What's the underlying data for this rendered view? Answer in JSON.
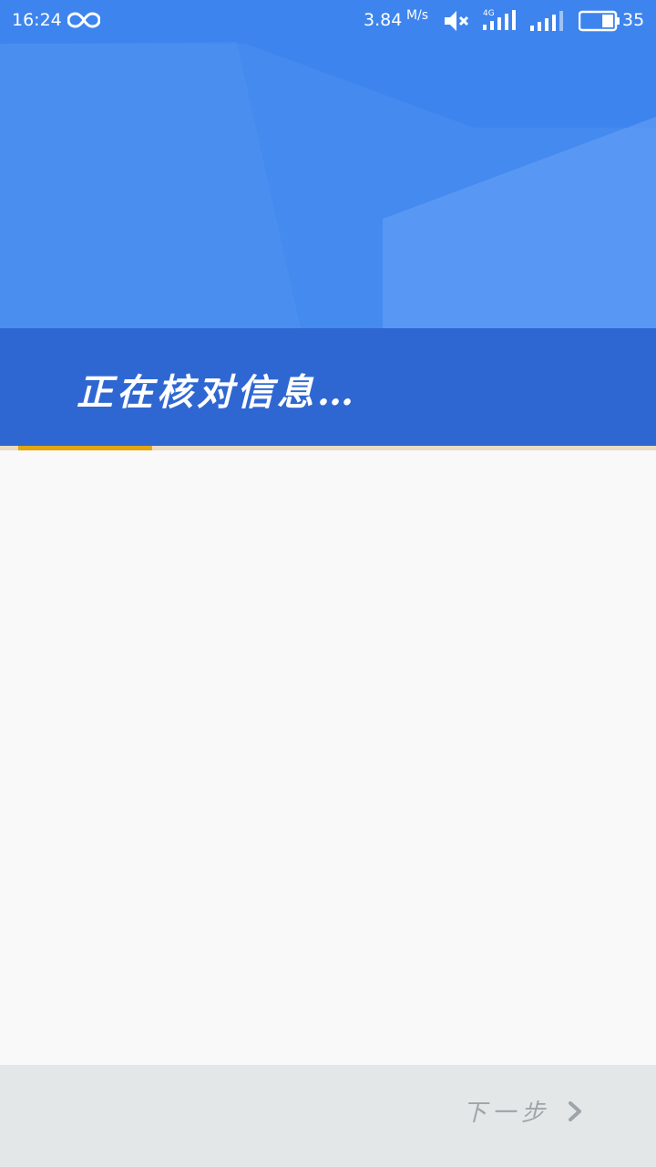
{
  "status_bar": {
    "time": "16:24",
    "net_speed": "3.84",
    "net_speed_unit": "M/s",
    "network_type": "4G",
    "battery_percent": "35",
    "battery_level": 0.35,
    "icons": [
      "infinity-icon",
      "mute-icon",
      "signal-4g-icon",
      "signal-icon",
      "battery-icon"
    ]
  },
  "hero": {
    "message": "正在核对信息…",
    "progress": 0.21,
    "colors": {
      "primary": "#3d84ee",
      "banner": "#2f67d2",
      "progress": "#e3a60f"
    }
  },
  "footer": {
    "next_label": "下一步",
    "next_icon": "chevron-right-icon"
  }
}
